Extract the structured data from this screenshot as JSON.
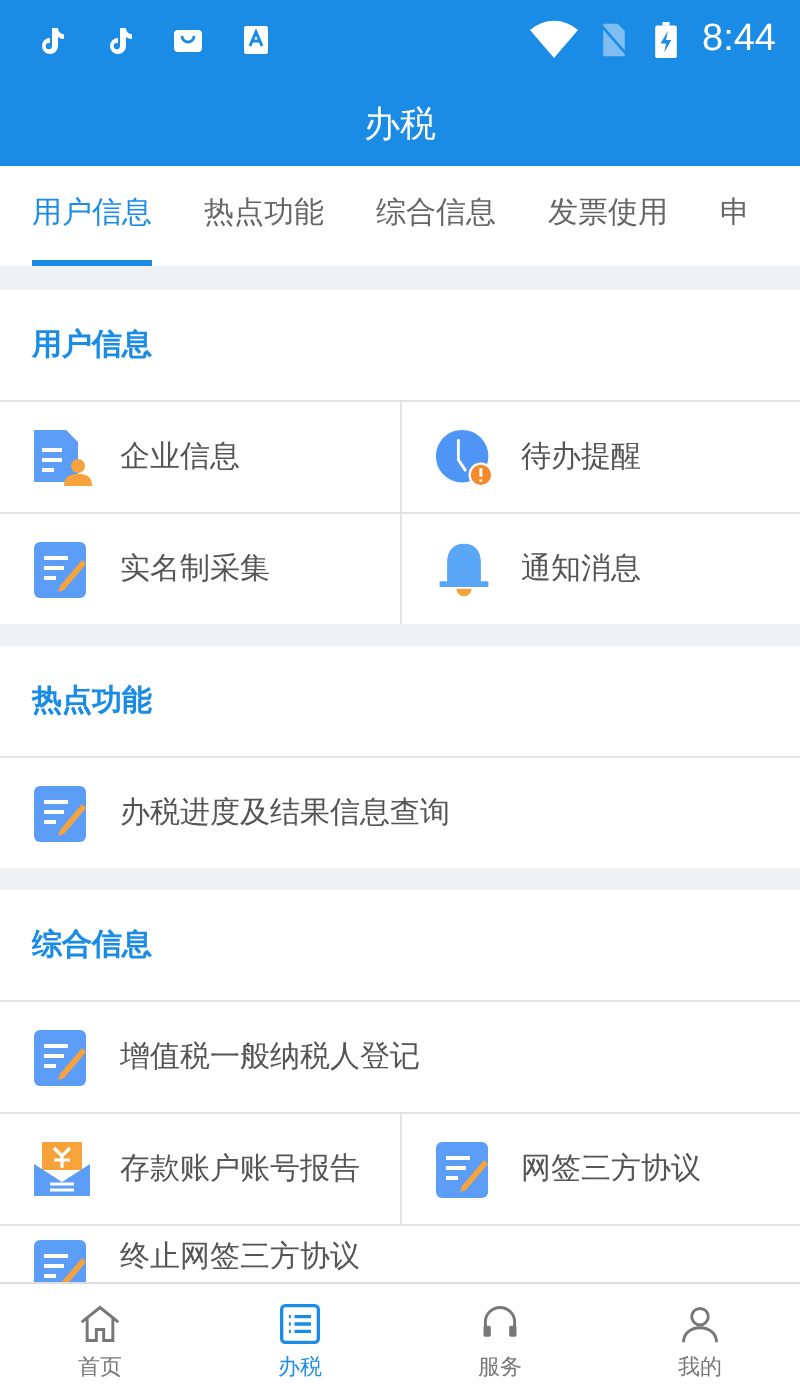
{
  "status_bar": {
    "time": "8:44"
  },
  "header": {
    "title": "办税"
  },
  "tabs": [
    {
      "label": "用户信息",
      "selected": true
    },
    {
      "label": "热点功能",
      "selected": false
    },
    {
      "label": "综合信息",
      "selected": false
    },
    {
      "label": "发票使用",
      "selected": false
    },
    {
      "label": "申",
      "selected": false
    }
  ],
  "sections": [
    {
      "title": "用户信息",
      "rows": [
        [
          {
            "label": "企业信息",
            "kind": "doc-user"
          },
          {
            "label": "待办提醒",
            "kind": "clock-alert"
          }
        ],
        [
          {
            "label": "实名制采集",
            "kind": "edit"
          },
          {
            "label": "通知消息",
            "kind": "bell"
          }
        ]
      ]
    },
    {
      "title": "热点功能",
      "rows": [
        [
          {
            "label": "办税进度及结果信息查询",
            "kind": "edit"
          }
        ]
      ]
    },
    {
      "title": "综合信息",
      "rows": [
        [
          {
            "label": "增值税一般纳税人登记",
            "kind": "edit"
          }
        ],
        [
          {
            "label": "存款账户账号报告",
            "kind": "yen-mail"
          },
          {
            "label": "网签三方协议",
            "kind": "edit"
          }
        ],
        [
          {
            "label": "终止网签三方协议",
            "kind": "edit"
          }
        ]
      ]
    }
  ],
  "bottom_nav": [
    {
      "label": "首页",
      "kind": "home",
      "selected": false
    },
    {
      "label": "办税",
      "kind": "list",
      "selected": true
    },
    {
      "label": "服务",
      "kind": "service",
      "selected": false
    },
    {
      "label": "我的",
      "kind": "person",
      "selected": false
    }
  ]
}
